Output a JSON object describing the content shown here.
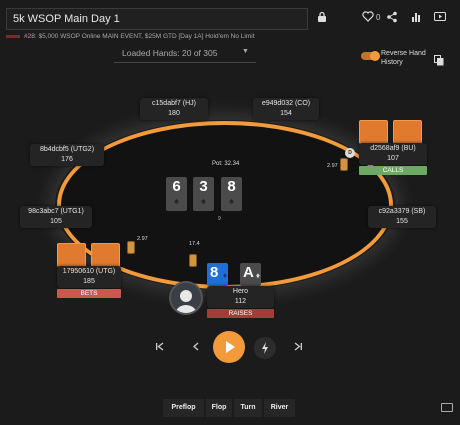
{
  "header": {
    "title": "5k WSOP Main Day 1",
    "subtitle": "#28: $5,000 WSOP Online MAIN EVENT, $25M GTD [Day 1A] Hold'em No Limit",
    "favorite_count": "0",
    "icons": [
      "lock-icon",
      "heart-icon",
      "share-icon",
      "stats-icon",
      "video-icon"
    ]
  },
  "controls_top": {
    "loaded_hands": "Loaded Hands: 20 of 305",
    "reverse_label": "Reverse Hand History",
    "reverse_enabled": true
  },
  "table": {
    "pot": "Pot: 32.34",
    "board": [
      {
        "rank": "6",
        "suit": "♠"
      },
      {
        "rank": "3",
        "suit": "♠"
      },
      {
        "rank": "8",
        "suit": "♠"
      }
    ],
    "board_number": "9",
    "dealer": "D",
    "players": {
      "hj": {
        "name": "c15dabf7 (HJ)",
        "stack": "180"
      },
      "co": {
        "name": "e949d032 (CO)",
        "stack": "154"
      },
      "utg2": {
        "name": "8b4dcbf5 (UTG2)",
        "stack": "176"
      },
      "bu": {
        "name": "d2568af9 (BU)",
        "stack": "107",
        "action": "CALLS"
      },
      "utg1": {
        "name": "98c3abc7 (UTG1)",
        "stack": "105"
      },
      "sb": {
        "name": "c92a3379 (SB)",
        "stack": "155"
      },
      "utg": {
        "name": "17950610 (UTG)",
        "stack": "185",
        "action": "BETS"
      },
      "hero": {
        "name": "Hero",
        "stack": "112",
        "action": "RAISES"
      }
    },
    "hero_cards": [
      {
        "rank": "8",
        "suit": "♦"
      },
      {
        "rank": "A",
        "suit": "♦"
      }
    ],
    "bets": {
      "bu": "2.97",
      "utg": "2.97",
      "hero": "17.4"
    }
  },
  "playback": {
    "streets": [
      "Preflop",
      "Flop",
      "Turn",
      "River"
    ]
  },
  "colors": {
    "accent": "#f39a3a",
    "calls": "#6ea865",
    "bets": "#c8594f",
    "raises": "#a83a3a",
    "hero_card": "#1e6fd9"
  }
}
